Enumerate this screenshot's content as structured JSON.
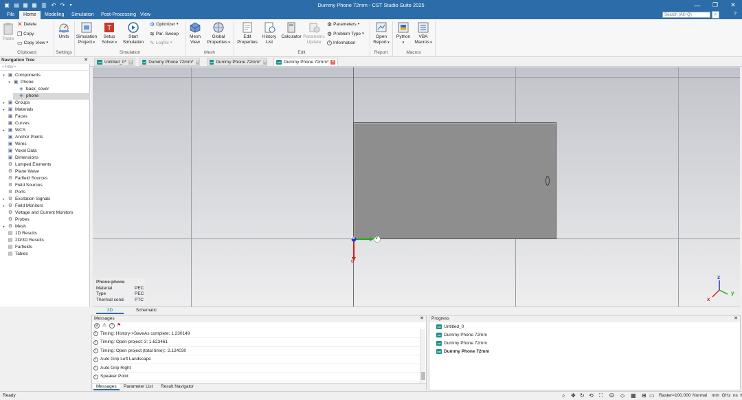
{
  "app": {
    "title": "Dummy Phone 72mm - CST Studio Suite 2025"
  },
  "menu": {
    "tabs": [
      "File",
      "Home",
      "Modeling",
      "Simulation",
      "Post-Processing",
      "View"
    ],
    "active": "Home",
    "search_placeholder": "Search (Alt+Q)"
  },
  "ribbon": {
    "clipboard": {
      "paste": "Paste",
      "delete": "Delete",
      "copy": "Copy",
      "copy_view": "Copy View",
      "label": "Clipboard"
    },
    "settings": {
      "units": "Units",
      "label": "Settings"
    },
    "simulation": {
      "project_l1": "Simulation",
      "project_l2": "Project",
      "solver_l1": "Setup",
      "solver_l2": "Solver",
      "start_l1": "Start",
      "start_l2": "Simulation",
      "optimizer": "Optimizer",
      "par_sweep": "Par. Sweep",
      "logfile": "Logfile",
      "label": "Simulation"
    },
    "mesh": {
      "view_l1": "Mesh",
      "view_l2": "View",
      "global_l1": "Global",
      "global_l2": "Properties",
      "label": "Mesh"
    },
    "edit": {
      "props_l1": "Edit",
      "props_l2": "Properties",
      "history_l1": "History",
      "history_l2": "List",
      "calculator": "Calculator",
      "param_l1": "Parametric",
      "param_l2": "Update",
      "parameters": "Parameters",
      "problem_type": "Problem Type",
      "information": "Information",
      "label": "Edit"
    },
    "report": {
      "open_l1": "Open",
      "open_l2": "Report",
      "label": "Report"
    },
    "macros": {
      "python": "Python",
      "vba_l1": "VBA",
      "vba_l2": "Macros",
      "label": "Macros"
    }
  },
  "nav": {
    "title": "Navigation Tree",
    "filter": "<Filter>",
    "items": [
      "Components",
      "Phone",
      "back_cover",
      "phone",
      "Groups",
      "Materials",
      "Faces",
      "Curves",
      "WCS",
      "Anchor Points",
      "Wires",
      "Voxel Data",
      "Dimensions",
      "Lumped Elements",
      "Plane Wave",
      "Farfield Sources",
      "Field Sources",
      "Ports",
      "Excitation Signals",
      "Field Monitors",
      "Voltage and Current Monitors",
      "Probes",
      "Mesh",
      "1D Results",
      "2D/3D Results",
      "Farfields",
      "Tables"
    ]
  },
  "doc_tabs": [
    "Untitled_0*",
    "Dummy Phone 72mm*",
    "Dummy Phone 72mm*",
    "Dummy Phone 72mm*"
  ],
  "viewport": {
    "axis_labels": {
      "w": "w",
      "u": "u",
      "v": "v"
    },
    "triad": {
      "x": "x",
      "y": "y",
      "z": "z"
    },
    "props": {
      "name": "Phone:phone",
      "rows": [
        [
          "Material",
          "PEC"
        ],
        [
          "Type",
          "PEC"
        ],
        [
          "Thermal cond.",
          "PTC"
        ]
      ]
    }
  },
  "view_tabs": [
    "3D",
    "Schematic"
  ],
  "messages": {
    "title": "Messages",
    "rows": [
      "Timing: History->SaveAs complete: 1.230149",
      "Timing: Open project: 3: 1.623461",
      "Timing: Open project (total time):: 2.124030",
      "Auto Grip Left Landscape",
      "Auto Grip Right",
      "Speaker Point"
    ],
    "tabs": [
      "Messages",
      "Parameter List",
      "Result Navigator"
    ]
  },
  "progress": {
    "title": "Progress",
    "rows": [
      "Untitled_0",
      "Dummy Phone 72mm",
      "Dummy Phone 72mm",
      "Dummy Phone 72mm"
    ]
  },
  "status": {
    "ready": "Ready",
    "raster": "Raster=100.000",
    "mode": "Normal",
    "units": "mm  GHz  ns  K"
  },
  "colors": {
    "titlebar": "#2c6ca8",
    "accent": "#2c6ca8",
    "phone_body": "#8e8e8e",
    "axis_w": "#2233cc",
    "axis_u": "#cc2222",
    "axis_v": "#22aa22"
  }
}
